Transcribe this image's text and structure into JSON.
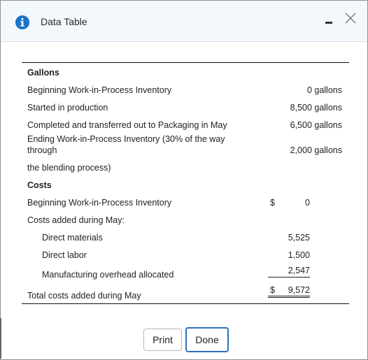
{
  "dialog": {
    "title": "Data Table",
    "icons": {
      "info": "info-icon",
      "minimize": "minimize-icon",
      "close": "close-icon"
    }
  },
  "table": {
    "gallons_heading": "Gallons",
    "gallons_rows": [
      {
        "label": "Beginning Work-in-Process Inventory",
        "value": "0 gallons"
      },
      {
        "label": "Started in production",
        "value": "8,500 gallons"
      },
      {
        "label": "Completed and transferred out to Packaging in May",
        "value": "6,500 gallons"
      },
      {
        "label_line1": "Ending Work-in-Process Inventory (30% of the way",
        "label_line2": "through",
        "value": "2,000 gallons"
      }
    ],
    "blending_line": "the blending process)",
    "costs_heading": "Costs",
    "beg_wip": {
      "label": "Beginning Work-in-Process Inventory",
      "currency": "$",
      "value": "0"
    },
    "costs_added_label": "Costs added during May:",
    "cost_items": [
      {
        "label": "Direct materials",
        "value": "5,525"
      },
      {
        "label": "Direct labor",
        "value": "1,500"
      },
      {
        "label": "Manufacturing overhead allocated",
        "value": "2,547"
      }
    ],
    "total": {
      "label": "Total costs added during May",
      "currency": "$",
      "value": "9,572"
    }
  },
  "buttons": {
    "print": "Print",
    "done": "Done"
  },
  "colors": {
    "accent": "#2e6fbf",
    "titlebar_bg": "#f3f8fc",
    "info_icon": "#1a73c7"
  }
}
